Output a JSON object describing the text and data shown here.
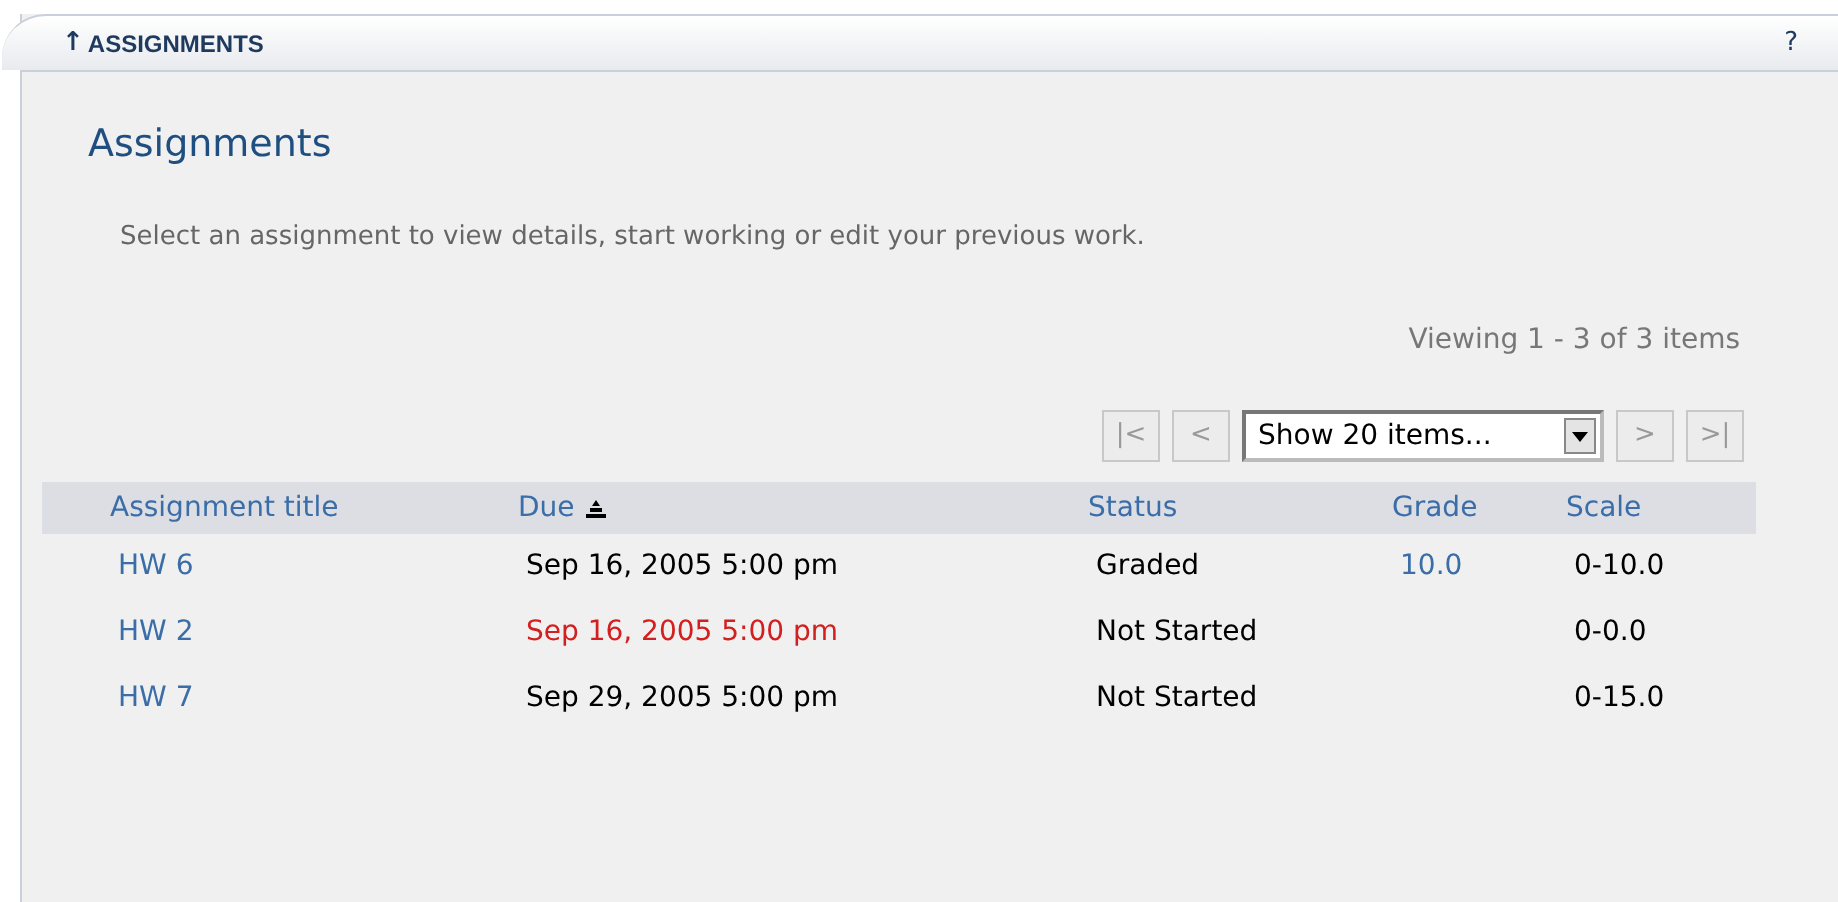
{
  "header": {
    "arrow": "↑",
    "title": "ASSIGNMENTS",
    "help": "?"
  },
  "heading": "Assignments",
  "instructions": "Select an assignment to view details, start working or edit your previous work.",
  "pager": {
    "summary": "Viewing 1 - 3 of 3 items",
    "first": "|<",
    "prev": "<",
    "select": "Show 20 items...",
    "next": ">",
    "last": ">|"
  },
  "table": {
    "columns": [
      {
        "label": "Assignment title",
        "sorted": false
      },
      {
        "label": "Due",
        "sorted": true
      },
      {
        "label": "Status",
        "sorted": false
      },
      {
        "label": "Grade",
        "sorted": false
      },
      {
        "label": "Scale",
        "sorted": false
      }
    ],
    "rows": [
      {
        "title": "HW 6",
        "due": "Sep 16, 2005 5:00 pm",
        "overdue": false,
        "status": "Graded",
        "grade": "10.0",
        "scale": "0-10.0"
      },
      {
        "title": "HW 2",
        "due": "Sep 16, 2005 5:00 pm",
        "overdue": true,
        "status": "Not Started",
        "scale": "0-0.0"
      },
      {
        "title": "HW 7",
        "due": "Sep 29, 2005 5:00 pm",
        "overdue": false,
        "status": "Not Started",
        "scale": "0-15.0"
      }
    ]
  }
}
